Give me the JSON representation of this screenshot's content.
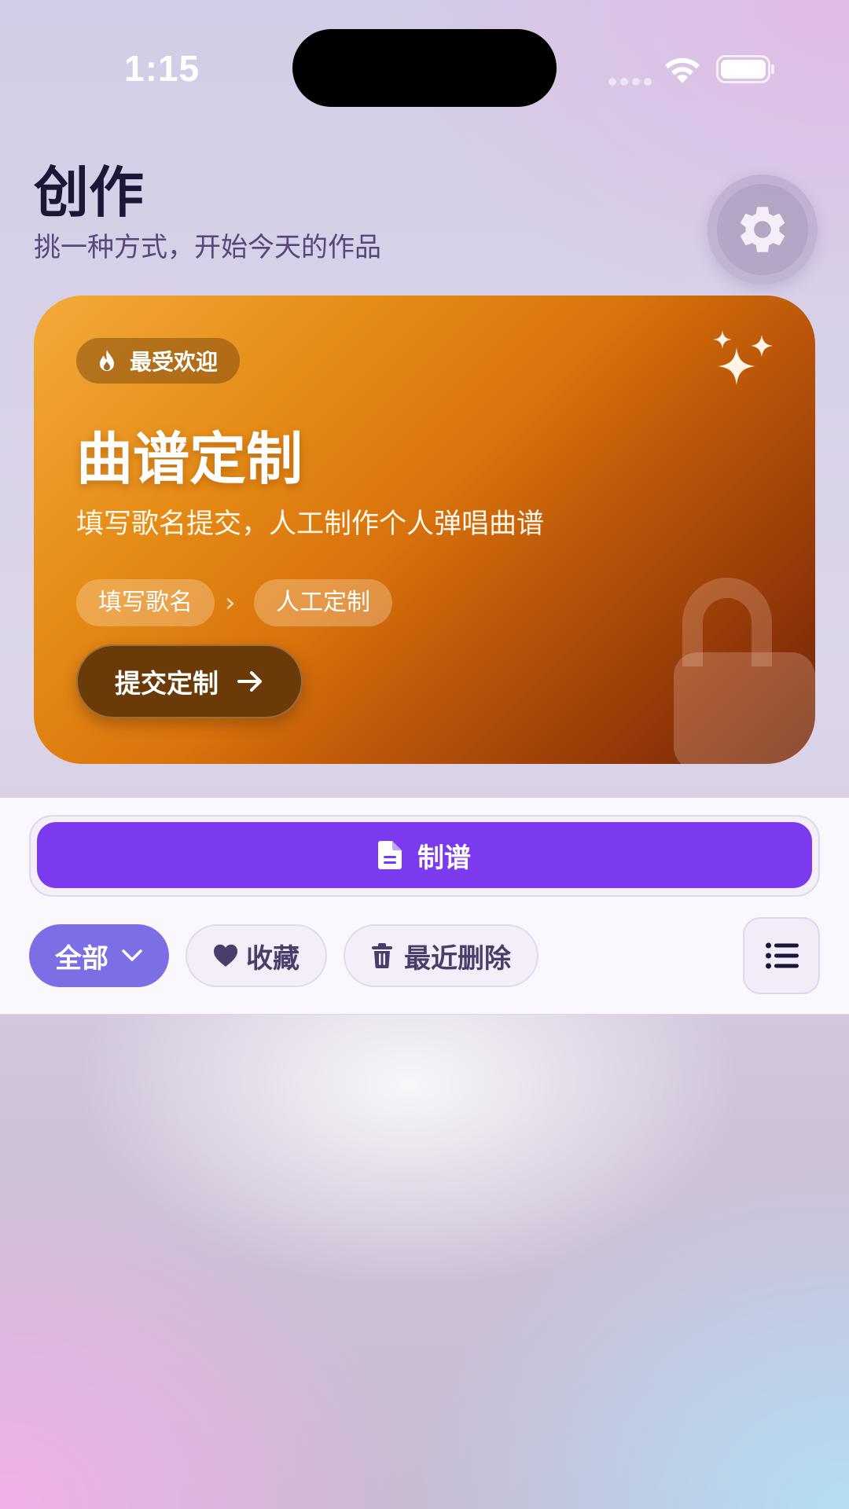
{
  "status_bar": {
    "time": "1:15"
  },
  "header": {
    "title": "创作",
    "subtitle": "挑一种方式，开始今天的作品",
    "settings_icon": "gear-icon"
  },
  "hero": {
    "badge": "最受欢迎",
    "badge_icon": "flame-icon",
    "title": "曲谱定制",
    "description": "填写歌名提交，人工制作个人弹唱曲谱",
    "steps": [
      "填写歌名",
      "人工定制"
    ],
    "cta_label": "提交定制",
    "cta_icon": "arrow-right-icon",
    "decor_icons": [
      "sparkle-icon",
      "lock-icon"
    ],
    "colors": {
      "gradient_start": "#f3aa3a",
      "gradient_end": "#6a2406",
      "cta_bg": "#6a3a08"
    }
  },
  "actions": {
    "primary_label": "制谱",
    "primary_icon": "document-icon",
    "primary_color": "#7b3aed"
  },
  "filters": {
    "items": [
      {
        "label": "全部",
        "active": true,
        "icon": "chevron-down-icon"
      },
      {
        "label": "收藏",
        "active": false,
        "icon": "heart-icon"
      },
      {
        "label": "最近删除",
        "active": false,
        "icon": "trash-icon"
      }
    ],
    "active_color": "#7c6fe6",
    "view_toggle_icon": "list-icon"
  }
}
